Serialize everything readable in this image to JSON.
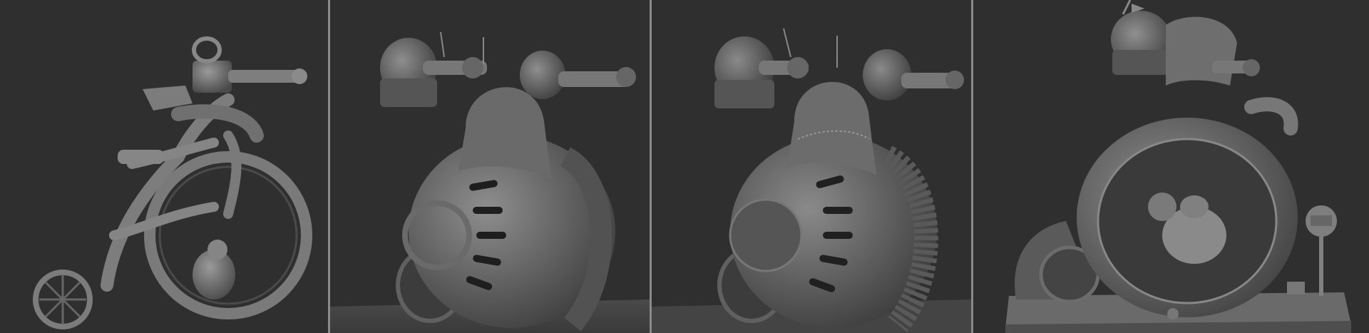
{
  "image": {
    "kind": "sculpt-progress-strip",
    "panels": [
      {
        "name": "stage-1-blockout-penny-farthing",
        "subject": "unicycle-bike-with-training-wheel-and-hamster"
      },
      {
        "name": "stage-2-wheel-pod-with-cannons",
        "subject": "round-wheel-vehicle-with-two-turrets"
      },
      {
        "name": "stage-3-wheel-pod-detailed",
        "subject": "round-wheel-vehicle-with-tread-detail"
      },
      {
        "name": "stage-4-final-diorama",
        "subject": "hamster-wheel-vehicle-on-base-with-sign"
      }
    ],
    "colors": {
      "background": "#2f2f2f",
      "divider": "#8a8a8a",
      "clay_light": "#8f8f8f",
      "clay_mid": "#6e6e6e",
      "clay_dark": "#3f3f3f"
    }
  }
}
